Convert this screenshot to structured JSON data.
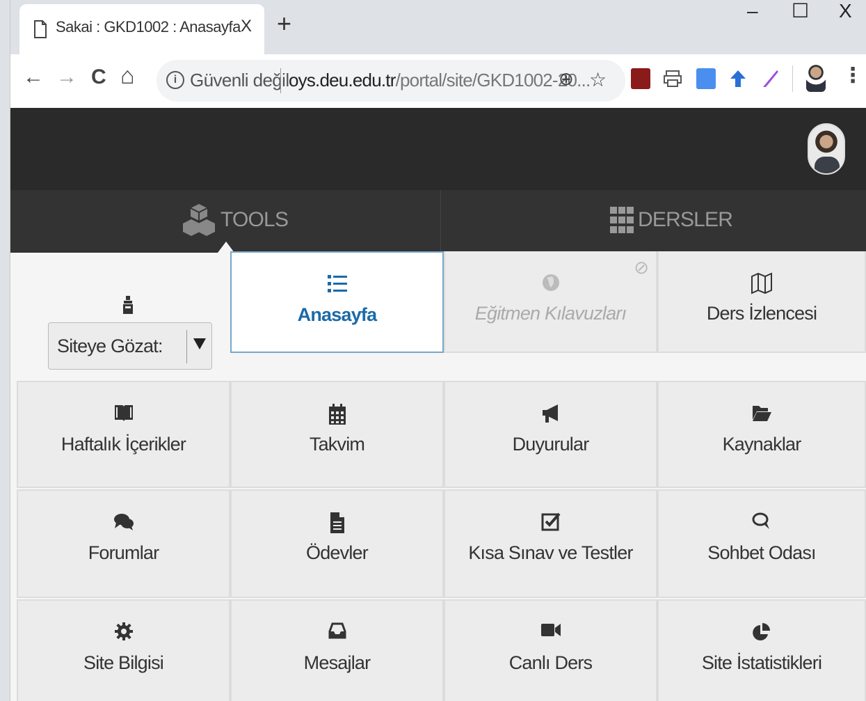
{
  "browser": {
    "tab_title": "Sakai : GKD1002 : Anasayfa",
    "tab_close": "X",
    "new_tab": "+",
    "win_min": "–",
    "win_max": "☐",
    "win_close": "X",
    "nav_back": "←",
    "nav_forward": "→",
    "nav_reload": "C",
    "nav_home": "⌂",
    "security_label": "Güvenli değil",
    "url_host": "oys.deu.edu.tr",
    "url_path": "/portal/site/GKD1002-20...",
    "zoom_icon": "⊕",
    "star_icon": "☆",
    "menu_icon": "⋮"
  },
  "portal": {
    "nav_tools_label": "TOOLS",
    "nav_ders_label": "DERSLER"
  },
  "browse": {
    "label": "Siteye Gözat:"
  },
  "tools": [
    {
      "label": "Anasayfa",
      "icon": "list-icon",
      "state": "active"
    },
    {
      "label": "Eğitmen Kılavuzları",
      "icon": "globe-icon",
      "state": "disabled"
    },
    {
      "label": "Ders İzlencesi",
      "icon": "map-icon",
      "state": "normal"
    },
    {
      "label": "Haftalık İçerikler",
      "icon": "book-icon",
      "state": "normal"
    },
    {
      "label": "Takvim",
      "icon": "calendar-icon",
      "state": "normal"
    },
    {
      "label": "Duyurular",
      "icon": "megaphone-icon",
      "state": "normal"
    },
    {
      "label": "Kaynaklar",
      "icon": "folder-open-icon",
      "state": "normal"
    },
    {
      "label": "Forumlar",
      "icon": "comments-icon",
      "state": "normal"
    },
    {
      "label": "Ödevler",
      "icon": "file-icon",
      "state": "normal"
    },
    {
      "label": "Kısa Sınav ve Testler",
      "icon": "checkbox-icon",
      "state": "normal"
    },
    {
      "label": "Sohbet Odası",
      "icon": "chat-icon",
      "state": "normal"
    },
    {
      "label": "Site Bilgisi",
      "icon": "gear-icon",
      "state": "normal"
    },
    {
      "label": "Mesajlar",
      "icon": "inbox-icon",
      "state": "normal"
    },
    {
      "label": "Canlı Ders",
      "icon": "video-camera-icon",
      "state": "normal"
    },
    {
      "label": "Site İstatistikleri",
      "icon": "pie-chart-icon",
      "state": "normal"
    }
  ],
  "colors": {
    "header_bg": "#2a2a2a",
    "nav_bg": "#333333",
    "active_text": "#1b6aa8",
    "cell_bg": "#ececec"
  }
}
